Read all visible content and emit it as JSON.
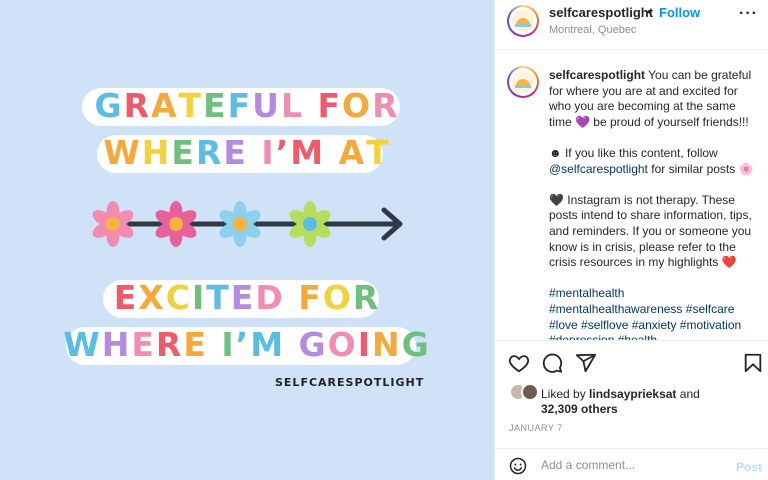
{
  "image": {
    "line1": [
      {
        "ch": "G",
        "c": "#5bbce4"
      },
      {
        "ch": "R",
        "c": "#f05a6b"
      },
      {
        "ch": "A",
        "c": "#f6a93b"
      },
      {
        "ch": "T",
        "c": "#f2d13a"
      },
      {
        "ch": "E",
        "c": "#6cc17e"
      },
      {
        "ch": "F",
        "c": "#5bbce4"
      },
      {
        "ch": "U",
        "c": "#b48be0"
      },
      {
        "ch": "L",
        "c": "#f28db2"
      },
      {
        "ch": " ",
        "c": "#000"
      },
      {
        "ch": "F",
        "c": "#f05a6b"
      },
      {
        "ch": "O",
        "c": "#f6a93b"
      },
      {
        "ch": "R",
        "c": "#f28db2"
      }
    ],
    "line2": [
      {
        "ch": "W",
        "c": "#f6a93b"
      },
      {
        "ch": "H",
        "c": "#f2d13a"
      },
      {
        "ch": "E",
        "c": "#6cc17e"
      },
      {
        "ch": "R",
        "c": "#5bbce4"
      },
      {
        "ch": "E",
        "c": "#b48be0"
      },
      {
        "ch": " ",
        "c": "#000"
      },
      {
        "ch": "I",
        "c": "#f28db2"
      },
      {
        "ch": "’",
        "c": "#f05a6b"
      },
      {
        "ch": "M",
        "c": "#f05a6b"
      },
      {
        "ch": " ",
        "c": "#000"
      },
      {
        "ch": "A",
        "c": "#f6a93b"
      },
      {
        "ch": "T",
        "c": "#f2d13a"
      }
    ],
    "line3": [
      {
        "ch": "E",
        "c": "#f05a6b"
      },
      {
        "ch": "X",
        "c": "#f6a93b"
      },
      {
        "ch": "C",
        "c": "#f2d13a"
      },
      {
        "ch": "I",
        "c": "#6cc17e"
      },
      {
        "ch": "T",
        "c": "#5bbce4"
      },
      {
        "ch": "E",
        "c": "#b48be0"
      },
      {
        "ch": "D",
        "c": "#f28db2"
      },
      {
        "ch": " ",
        "c": "#000"
      },
      {
        "ch": "F",
        "c": "#f6a93b"
      },
      {
        "ch": "O",
        "c": "#f2d13a"
      },
      {
        "ch": "R",
        "c": "#6cc17e"
      }
    ],
    "line4": [
      {
        "ch": "W",
        "c": "#5bbce4"
      },
      {
        "ch": "H",
        "c": "#b48be0"
      },
      {
        "ch": "E",
        "c": "#f28db2"
      },
      {
        "ch": "R",
        "c": "#f05a6b"
      },
      {
        "ch": "E",
        "c": "#f6a93b"
      },
      {
        "ch": " ",
        "c": "#000"
      },
      {
        "ch": "I",
        "c": "#6cc17e"
      },
      {
        "ch": "’",
        "c": "#5bbce4"
      },
      {
        "ch": "M",
        "c": "#5bbce4"
      },
      {
        "ch": " ",
        "c": "#000"
      },
      {
        "ch": "G",
        "c": "#b48be0"
      },
      {
        "ch": "O",
        "c": "#f28db2"
      },
      {
        "ch": "I",
        "c": "#f05a6b"
      },
      {
        "ch": "N",
        "c": "#f6a93b"
      },
      {
        "ch": "G",
        "c": "#6cc17e"
      }
    ],
    "flowers": [
      {
        "petal": "#f28db2",
        "center": "#f6b440"
      },
      {
        "petal": "#e7609a",
        "center": "#f6b440"
      },
      {
        "petal": "#8fd0ec",
        "center": "#f6b440"
      },
      {
        "petal": "#b5de5c",
        "center": "#5bbce4"
      }
    ],
    "credit": "SELFCARESPOTLIGHT"
  },
  "header": {
    "username": "selfcarespotlight",
    "dot": "•",
    "follow": "Follow",
    "location": "Montreal, Quebec",
    "more": "···"
  },
  "caption": {
    "username": "selfcarespotlight",
    "text1": "You can be grateful for where you are at and excited for who you are becoming at the same time 💜 be proud of yourself friends!!!",
    "p2_prefix": "☻ If you like this content, follow",
    "p2_mention": "@selfcarespotlight",
    "p2_suffix": "for similar posts 🌸",
    "p3": "🖤 Instagram is not therapy. These posts intend to share information, tips, and reminders. If you or someone you know is in crisis, please refer to the crisis resources in my highlights ❤️",
    "hashtags": [
      "#mentalhealth",
      "#mentalhealthawareness",
      "#selfcare",
      "#love",
      "#selflove",
      "#anxiety",
      "#motivation",
      "#depression",
      "#health"
    ]
  },
  "actions": {
    "icons": [
      "heart-icon",
      "comment-icon",
      "share-icon",
      "bookmark-icon"
    ],
    "liked_by_prefix": "Liked by",
    "liked_by_user": "lindsayprieksat",
    "liked_by_and": "and",
    "others": "32,309 others",
    "date": "JANUARY 7"
  },
  "comment": {
    "placeholder": "Add a comment...",
    "post": "Post"
  },
  "colors": {
    "background_image": "#cfe2f8",
    "link_blue": "#0095f6",
    "hashtag": "#00376b"
  }
}
